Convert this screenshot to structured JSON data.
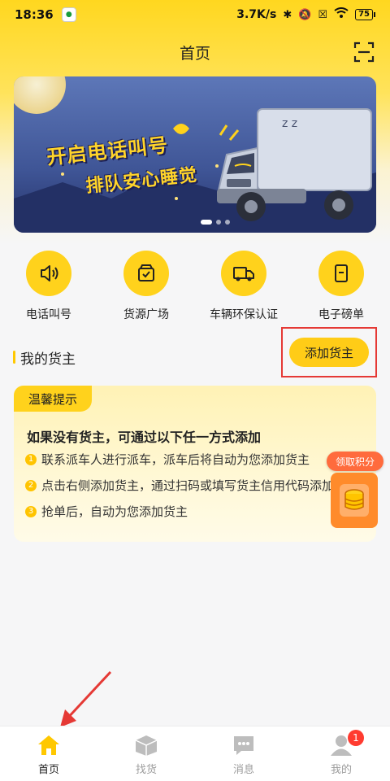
{
  "status_bar": {
    "time": "18:36",
    "network_speed": "3.7K/s",
    "battery": "75"
  },
  "header": {
    "title": "首页"
  },
  "banner": {
    "line1": "开启电话叫号",
    "line2": "排队安心睡觉"
  },
  "quick_actions": [
    {
      "label": "电话叫号",
      "icon": "speaker-icon"
    },
    {
      "label": "货源广场",
      "icon": "cargo-box-icon"
    },
    {
      "label": "车辆环保认证",
      "icon": "truck-icon"
    },
    {
      "label": "电子磅单",
      "icon": "document-icon"
    }
  ],
  "my_shippers": {
    "title": "我的货主",
    "add_button": "添加货主"
  },
  "tip_card": {
    "tag": "温馨提示",
    "heading": "如果没有货主，可通过以下任一方式添加",
    "items": [
      {
        "num": "1",
        "text": "联系派车人进行派车，派车后将自动为您添加货主"
      },
      {
        "num": "2",
        "text": "点击右侧添加货主，通过扫码或填写货主信用代码添加"
      },
      {
        "num": "3",
        "text": "抢单后，自动为您添加货主"
      }
    ]
  },
  "points_float": {
    "label": "领取积分"
  },
  "tab_bar": {
    "tabs": [
      {
        "label": "首页",
        "icon": "home-icon"
      },
      {
        "label": "找货",
        "icon": "box-icon"
      },
      {
        "label": "消息",
        "icon": "message-icon"
      },
      {
        "label": "我的",
        "icon": "profile-icon"
      }
    ],
    "badge": "1"
  },
  "colors": {
    "brand_yellow": "#ffd21c",
    "badge_red": "#ff3b30",
    "points_orange": "#ff8b2b"
  }
}
